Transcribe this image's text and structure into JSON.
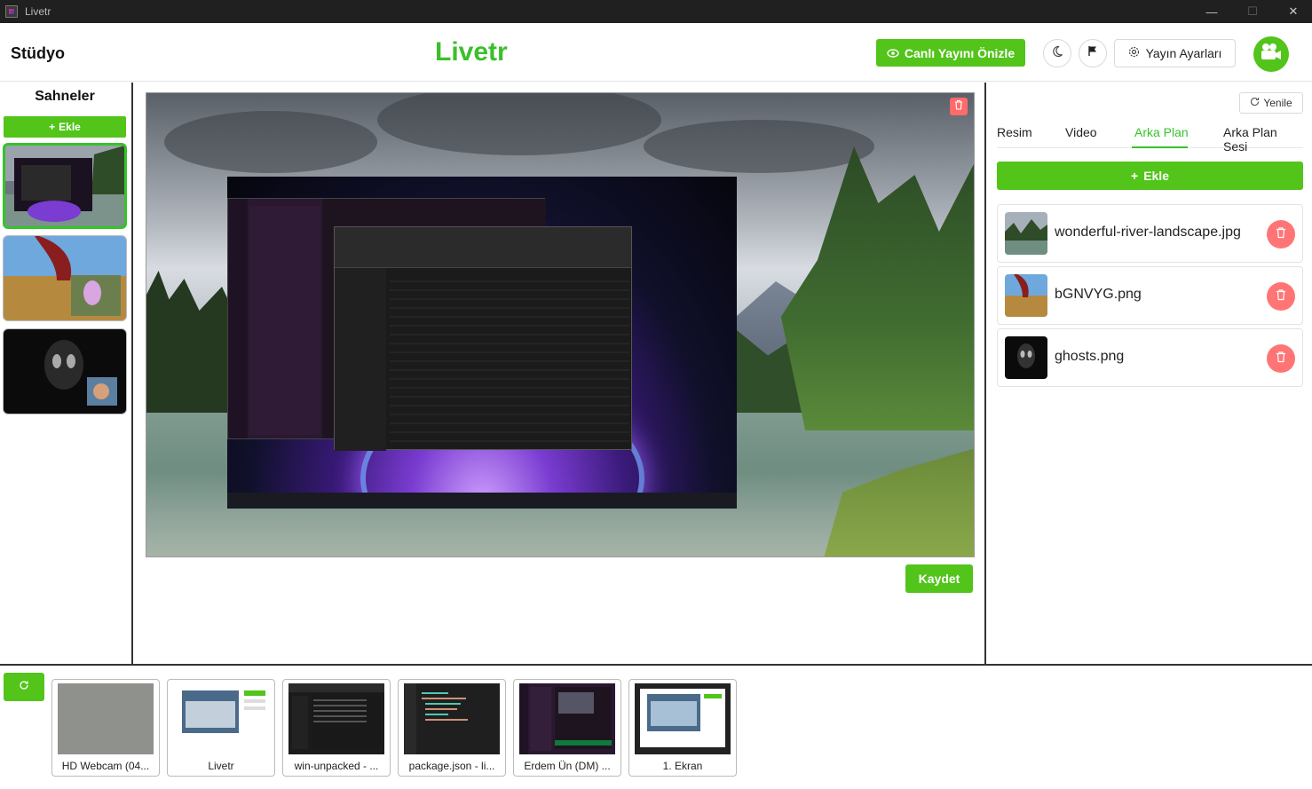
{
  "window": {
    "title": "Livetr"
  },
  "header": {
    "studio_title": "Stüdyo",
    "brand": "Livetr",
    "preview_button": "Canlı Yayını Önizle",
    "settings_button": "Yayın Ayarları"
  },
  "scenes": {
    "title": "Sahneler",
    "add_label": "Ekle",
    "items": [
      {
        "name": "scene-1",
        "active": true
      },
      {
        "name": "scene-2",
        "active": false
      },
      {
        "name": "scene-3",
        "active": false
      }
    ]
  },
  "canvas": {
    "save_label": "Kaydet"
  },
  "right_panel": {
    "refresh_label": "Yenile",
    "tabs": [
      {
        "label": "Resim",
        "active": false
      },
      {
        "label": "Video",
        "active": false
      },
      {
        "label": "Arka Plan",
        "active": true
      },
      {
        "label": "Arka Plan Sesi",
        "active": false
      }
    ],
    "add_label": "Ekle",
    "media": [
      {
        "name": "wonderful-river-landscape.jpg"
      },
      {
        "name": "bGNVYG.png"
      },
      {
        "name": "ghosts.png"
      }
    ]
  },
  "sources": [
    {
      "label": "HD Webcam (04..."
    },
    {
      "label": "Livetr"
    },
    {
      "label": "win-unpacked - ..."
    },
    {
      "label": "package.json - li..."
    },
    {
      "label": "Erdem Ün (DM) ..."
    },
    {
      "label": "1. Ekran"
    }
  ],
  "colors": {
    "accent": "#52c41a",
    "brand": "#3bbf2b",
    "danger": "#ff7575",
    "titlebar": "#202020"
  }
}
